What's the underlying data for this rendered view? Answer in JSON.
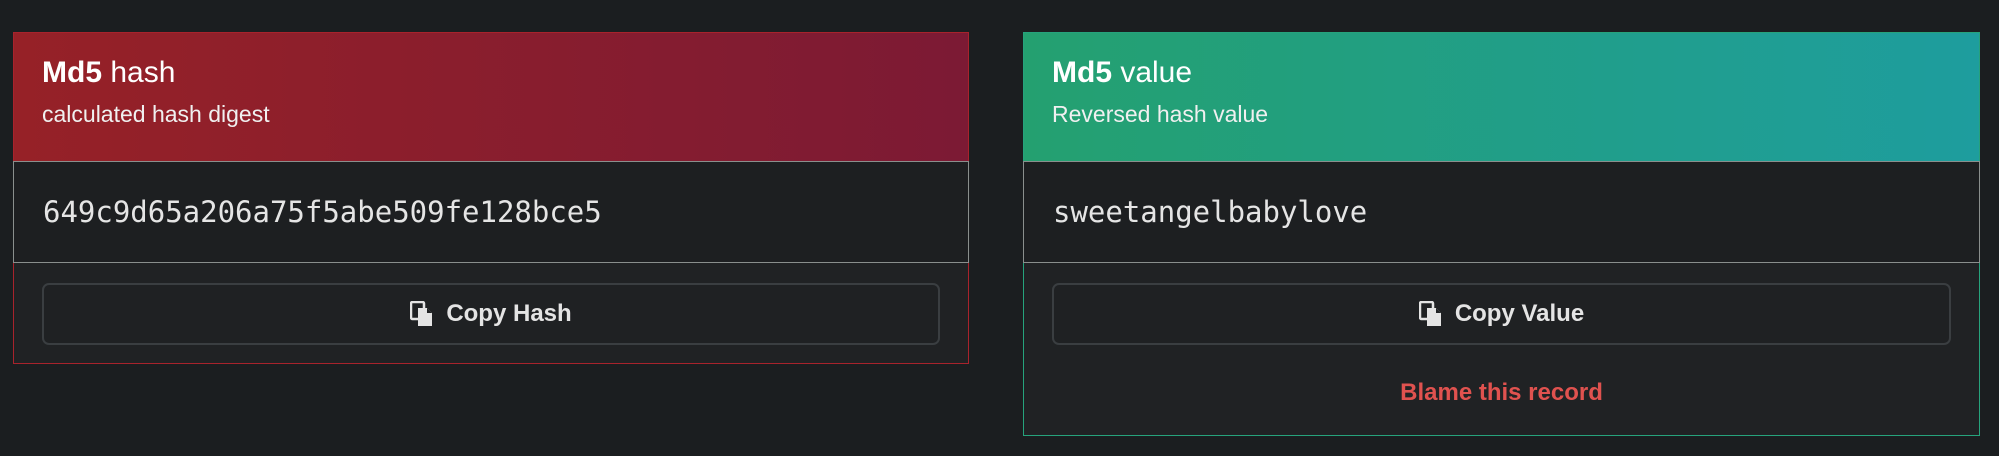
{
  "hash_card": {
    "title_bold": "Md5",
    "title_rest": " hash",
    "subtitle": "calculated hash digest",
    "hash_value": "649c9d65a206a75f5abe509fe128bce5",
    "copy_label": "Copy Hash",
    "header_color_start": "#962127",
    "header_color_end": "#7c1a34",
    "border_color": "#a8232c"
  },
  "value_card": {
    "title_bold": "Md5",
    "title_rest": " value",
    "subtitle": "Reversed hash value",
    "plain_value": "sweetangelbabylove",
    "copy_label": "Copy Value",
    "blame_label": "Blame this record",
    "header_color_start": "#24a070",
    "header_color_end": "#1e9d9e",
    "border_color": "#26a37c",
    "blame_color": "#e0524f"
  },
  "icons": {
    "copy": "copy-icon"
  }
}
